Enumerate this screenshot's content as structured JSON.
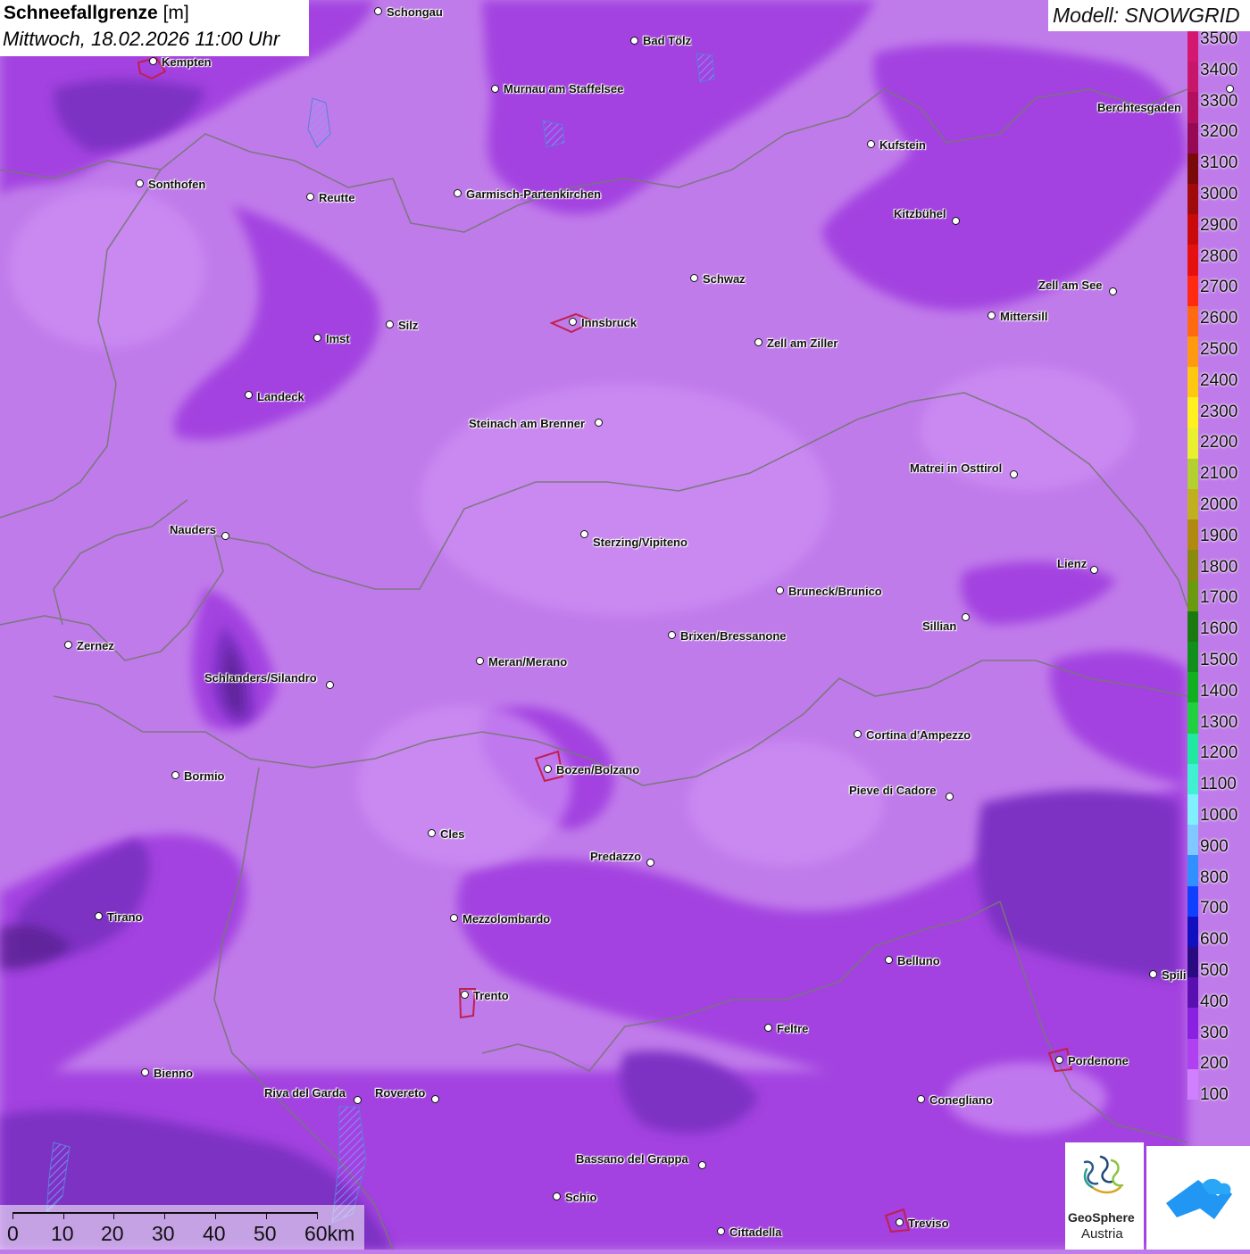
{
  "title": {
    "parameter": "Schneefallgrenze",
    "unit": "[m]",
    "datetime": "Mittwoch, 18.02.2026 11:00 Uhr"
  },
  "model_label": "Modell: SNOWGRID",
  "colors": {
    "base_fill": "#c07bea",
    "low_fill": "#a040e0",
    "lowest_fill": "#7a2bc0",
    "deep_fill": "#5c2290",
    "border_line": "#777777"
  },
  "legend": {
    "labels": [
      "3500",
      "3400",
      "3300",
      "3200",
      "3100",
      "3000",
      "2900",
      "2800",
      "2700",
      "2600",
      "2500",
      "2400",
      "2300",
      "2200",
      "2100",
      "2000",
      "1900",
      "1800",
      "1700",
      "1600",
      "1500",
      "1400",
      "1300",
      "1200",
      "1100",
      "1000",
      "900",
      "800",
      "700",
      "600",
      "500",
      "400",
      "300",
      "200",
      "100"
    ],
    "colors": [
      "#d4176f",
      "#c8176b",
      "#b40f5f",
      "#960a55",
      "#7a0a0a",
      "#a00a0a",
      "#c80a0a",
      "#e61010",
      "#ff2a10",
      "#ff6a10",
      "#ff9a10",
      "#ffc810",
      "#fff020",
      "#e8f030",
      "#b4d030",
      "#c0b020",
      "#b08a10",
      "#8a8a10",
      "#6a9a10",
      "#1a7a10",
      "#10901a",
      "#10b020",
      "#20d040",
      "#20e8a0",
      "#40f0d0",
      "#80f0ff",
      "#80c8ff",
      "#3090ff",
      "#1040ff",
      "#1010c0",
      "#2a0a80",
      "#5a10b0",
      "#8a20e0",
      "#b040f0",
      "#d080ff"
    ]
  },
  "cities": [
    {
      "name": "Schongau",
      "icon": "city-dot-icon"
    },
    {
      "name": "Bad Tölz",
      "icon": "city-dot-icon"
    },
    {
      "name": "Kempten",
      "icon": "city-dot-icon"
    },
    {
      "name": "Murnau am Staffelsee",
      "icon": "city-dot-icon"
    },
    {
      "name": "Berchtesgaden",
      "icon": "city-dot-icon"
    },
    {
      "name": "Kufstein",
      "icon": "city-dot-icon"
    },
    {
      "name": "Sonthofen",
      "icon": "city-dot-icon"
    },
    {
      "name": "Reutte",
      "icon": "city-dot-icon"
    },
    {
      "name": "Garmisch-Partenkirchen",
      "icon": "city-dot-icon"
    },
    {
      "name": "Kitzbühel",
      "icon": "city-dot-icon"
    },
    {
      "name": "Schwaz",
      "icon": "city-dot-icon"
    },
    {
      "name": "Zell am See",
      "icon": "city-dot-icon"
    },
    {
      "name": "Mittersill",
      "icon": "city-dot-icon"
    },
    {
      "name": "Innsbruck",
      "icon": "city-dot-icon"
    },
    {
      "name": "Silz",
      "icon": "city-dot-icon"
    },
    {
      "name": "Imst",
      "icon": "city-dot-icon"
    },
    {
      "name": "Zell am Ziller",
      "icon": "city-dot-icon"
    },
    {
      "name": "Landeck",
      "icon": "city-dot-icon"
    },
    {
      "name": "Steinach am Brenner",
      "icon": "city-dot-icon"
    },
    {
      "name": "Matrei in Osttirol",
      "icon": "city-dot-icon"
    },
    {
      "name": "Nauders",
      "icon": "city-dot-icon"
    },
    {
      "name": "Sterzing/Vipiteno",
      "icon": "city-dot-icon"
    },
    {
      "name": "Lienz",
      "icon": "city-dot-icon"
    },
    {
      "name": "Bruneck/Brunico",
      "icon": "city-dot-icon"
    },
    {
      "name": "Sillian",
      "icon": "city-dot-icon"
    },
    {
      "name": "Brixen/Bressanone",
      "icon": "city-dot-icon"
    },
    {
      "name": "Zernez",
      "icon": "city-dot-icon"
    },
    {
      "name": "Meran/Merano",
      "icon": "city-dot-icon"
    },
    {
      "name": "Schlanders/Silandro",
      "icon": "city-dot-icon"
    },
    {
      "name": "Cortina d'Ampezzo",
      "icon": "city-dot-icon"
    },
    {
      "name": "Bozen/Bolzano",
      "icon": "city-dot-icon"
    },
    {
      "name": "Bormio",
      "icon": "city-dot-icon"
    },
    {
      "name": "Pieve di Cadore",
      "icon": "city-dot-icon"
    },
    {
      "name": "Cles",
      "icon": "city-dot-icon"
    },
    {
      "name": "Predazzo",
      "icon": "city-dot-icon"
    },
    {
      "name": "Tirano",
      "icon": "city-dot-icon"
    },
    {
      "name": "Mezzolombardo",
      "icon": "city-dot-icon"
    },
    {
      "name": "Belluno",
      "icon": "city-dot-icon"
    },
    {
      "name": "Spili",
      "icon": "city-dot-icon"
    },
    {
      "name": "Trento",
      "icon": "city-dot-icon"
    },
    {
      "name": "Feltre",
      "icon": "city-dot-icon"
    },
    {
      "name": "Pordenone",
      "icon": "city-dot-icon"
    },
    {
      "name": "Bienno",
      "icon": "city-dot-icon"
    },
    {
      "name": "Riva del Garda",
      "icon": "city-dot-icon"
    },
    {
      "name": "Rovereto",
      "icon": "city-dot-icon"
    },
    {
      "name": "Conegliano",
      "icon": "city-dot-icon"
    },
    {
      "name": "Bassano del Grappa",
      "icon": "city-dot-icon"
    },
    {
      "name": "Schio",
      "icon": "city-dot-icon"
    },
    {
      "name": "Treviso",
      "icon": "city-dot-icon"
    },
    {
      "name": "Cittadella",
      "icon": "city-dot-icon"
    }
  ],
  "scalebar": {
    "labels": [
      "0",
      "10",
      "20",
      "30",
      "40",
      "50",
      "60km"
    ]
  },
  "logos": {
    "geosphere_line1": "GeoSphere",
    "geosphere_line2": "Austria",
    "geosphere_icon": "geosphere-logo-icon",
    "blue_icon": "weather-app-logo-icon"
  }
}
